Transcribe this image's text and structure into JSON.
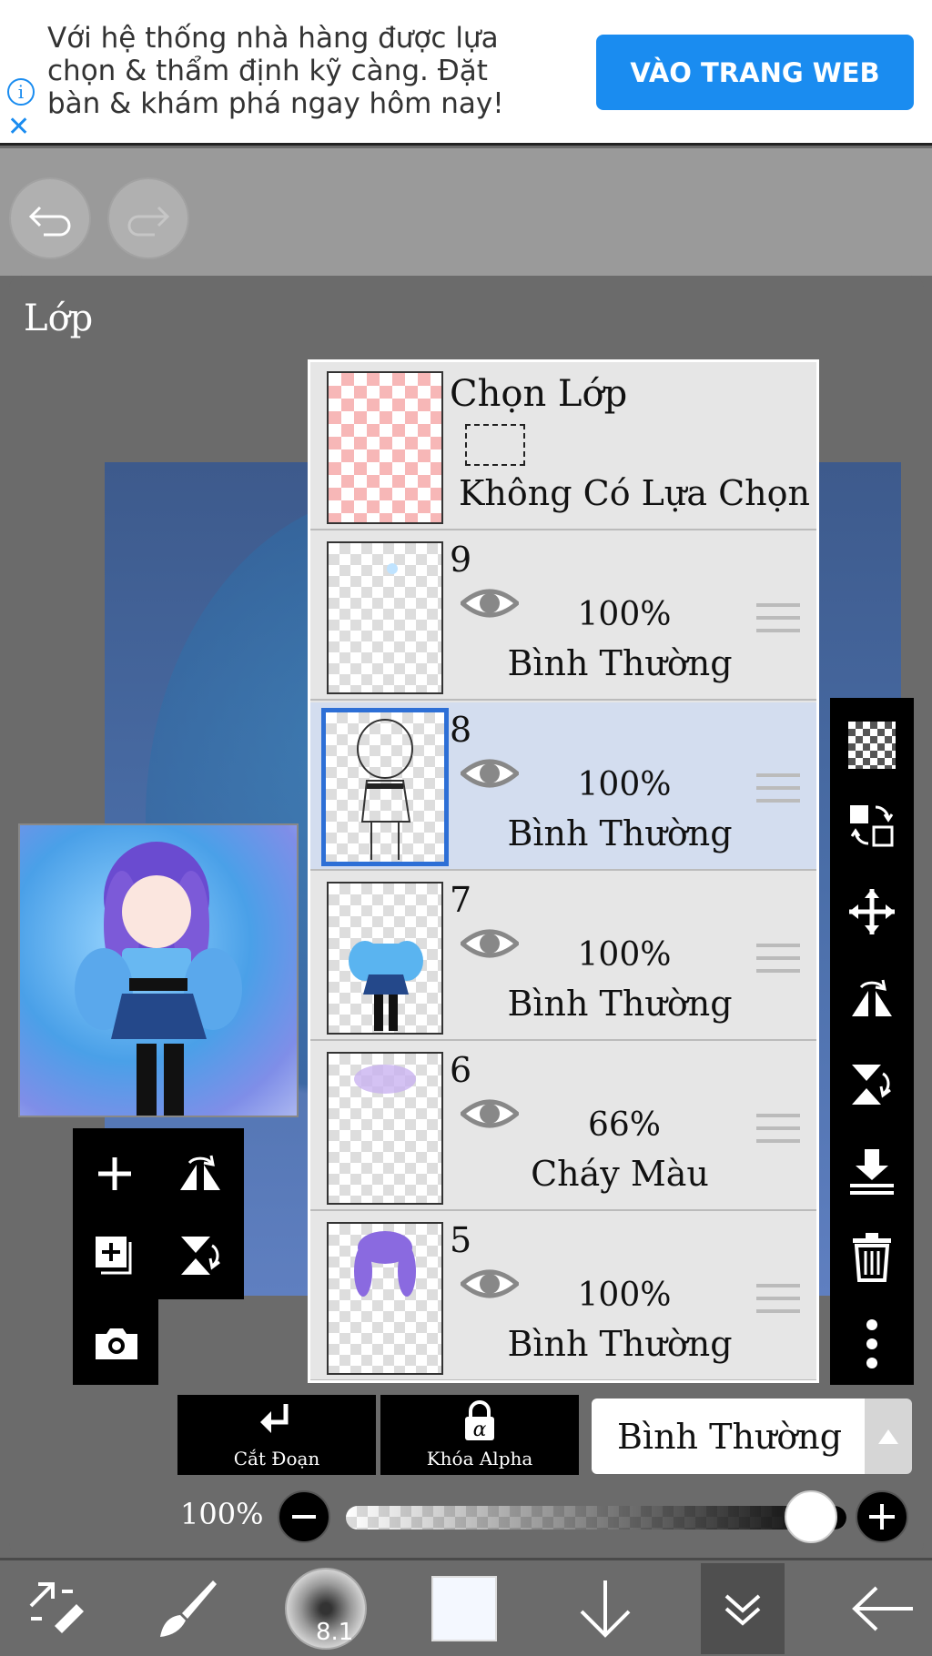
{
  "ad": {
    "text": "Với hệ thống nhà hàng được lựa chọn & thẩm định kỹ càng. Đặt bàn & khám phá ngay hôm nay!",
    "button": "VÀO TRANG WEB",
    "info_icon": "info-icon",
    "close_icon": "close-icon",
    "accent": "#1a8cf0"
  },
  "toolbar": {
    "undo_icon": "undo-icon",
    "redo_icon": "redo-icon"
  },
  "panel": {
    "title": "Lớp"
  },
  "selection_layer": {
    "title": "Chọn Lớp",
    "subtitle": "Không Có Lựa Chọn"
  },
  "layers": [
    {
      "number": "9",
      "opacity": "100%",
      "blend": "Bình Thường",
      "selected": false
    },
    {
      "number": "8",
      "opacity": "100%",
      "blend": "Bình Thường",
      "selected": true
    },
    {
      "number": "7",
      "opacity": "100%",
      "blend": "Bình Thường",
      "selected": false
    },
    {
      "number": "6",
      "opacity": "66%",
      "blend": "Cháy Màu",
      "selected": false
    },
    {
      "number": "5",
      "opacity": "100%",
      "blend": "Bình Thường",
      "selected": false
    }
  ],
  "bottom_controls": {
    "clip_label": "Cắt Đoạn",
    "alpha_lock_label": "Khóa Alpha",
    "blend_mode": "Bình Thường",
    "opacity_label": "100%",
    "opacity_value": 1.0
  },
  "brush": {
    "size": "8.1"
  },
  "colors": {
    "selected_layer_bg": "#d3ddef",
    "selected_layer_border": "#2d6fd6"
  }
}
